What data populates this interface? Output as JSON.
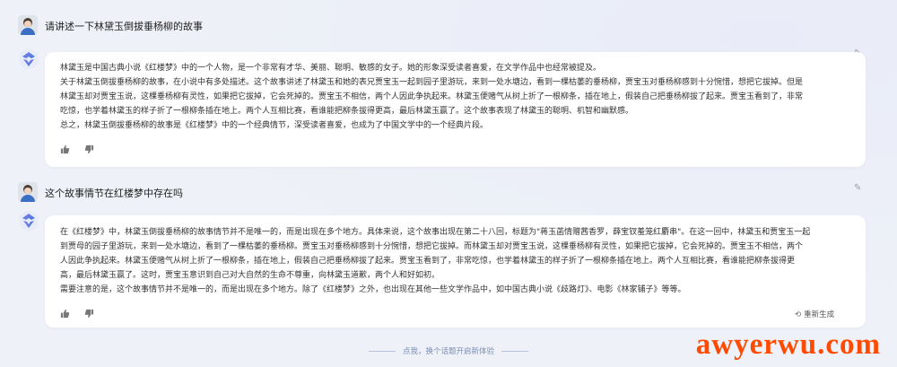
{
  "conversation": [
    {
      "question": "请讲述一下林黛玉倒拔垂杨柳的故事",
      "answer_lines": [
        "林黛玉是中国古典小说《红楼梦》中的一个人物，是一个非常有才华、美丽、聪明、敏感的女子。她的形象深受读者喜爱，在文学作品中也经常被提及。",
        "关于林黛玉倒拔垂杨柳的故事，在小说中有多处描述。这个故事讲述了林黛玉和她的表兄贾宝玉一起到园子里游玩，来到一处水塘边，看到一棵枯萎的垂杨柳，贾宝玉对垂杨柳感到十分惋惜，想把它拔掉。但是",
        "林黛玉却对贾宝玉说，这棵垂杨柳有灵性，如果把它拔掉，它会死掉的。贾宝玉不相信，两个人因此争执起来。林黛玉便赌气从树上折了一根柳条，插在地上，假装自己把垂杨柳拔了起来。贾宝玉看到了，非常",
        "吃惊，也学着林黛玉的样子折了一根柳条插在地上。两个人互相比赛，看谁能把柳条拔得更高，最后林黛玉赢了。这个故事表现了林黛玉的聪明、机智和幽默感。",
        "总之，林黛玉倒拔垂杨柳的故事是《红楼梦》中的一个经典情节，深受读者喜爱，也成为了中国文学中的一个经典片段。"
      ]
    },
    {
      "question": "这个故事情节在红楼梦中存在吗",
      "answer_lines": [
        "在《红楼梦》中，林黛玉倒拔垂杨柳的故事情节并不是唯一的，而是出现在多个地方。具体来说，这个故事出现在第二十八回，标题为\"蒋玉菡情赠茜香罗，薛宝钗羞笼红麝串\"。在这一回中，林黛玉和贾宝玉一起",
        "到贾母的园子里游玩，来到一处水塘边，看到了一棵枯萎的垂杨柳。贾宝玉对垂杨柳感到十分惋惜，想把它拔掉。而林黛玉却对贾宝玉说，这棵垂杨柳有灵性，如果把它拔掉，它会死掉的。贾宝玉不相信，两个",
        "人因此争执起来。林黛玉便赌气从树上折了一根柳条，插在地上，假装自己把垂杨柳拔了起来。贾宝玉看到了，非常吃惊，也学着林黛玉的样子折了一根柳条插在地上。两个人互相比赛，看谁能把柳条拔得更",
        "高，最后林黛玉赢了。这时，贾宝玉意识到自己对大自然的生命不尊重，向林黛玉道歉，两个人和好如初。",
        "需要注意的是，这个故事情节并不是唯一的，而是出现在多个地方。除了《红楼梦》之外，也出现在其他一些文学作品中，如中国古典小说《歧路灯》、电影《林家铺子》等等。"
      ],
      "regenerate_label": "重新生成"
    }
  ],
  "footer_hint": "点我，换个话题开启新体验",
  "watermark": "awyerwu.com",
  "colors": {
    "accent": "#5b6bd6",
    "watermark": "#ff4a00",
    "hint": "#7d8fb5"
  },
  "icons": [
    "user-avatar",
    "bot-logo-icon",
    "edit-pencil-icon",
    "thumb-up-icon",
    "thumb-down-icon",
    "refresh-icon"
  ]
}
